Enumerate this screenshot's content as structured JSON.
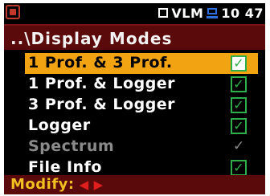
{
  "status": {
    "left_icon": "record-stop-icon",
    "box_icon": "square-outline-icon",
    "mode_text": "VLM",
    "usb_icon": "usb-monitor-icon",
    "time": "10 47"
  },
  "title": "..\\Display Modes",
  "items": [
    {
      "label": "1 Prof. & 3 Prof.",
      "checked": true,
      "enabled": true,
      "selected": true
    },
    {
      "label": "1 Prof. & Logger",
      "checked": true,
      "enabled": true,
      "selected": false
    },
    {
      "label": "3 Prof. & Logger",
      "checked": true,
      "enabled": true,
      "selected": false
    },
    {
      "label": "Logger",
      "checked": true,
      "enabled": true,
      "selected": false
    },
    {
      "label": "Spectrum",
      "checked": true,
      "enabled": false,
      "selected": false
    },
    {
      "label": "File Info",
      "checked": true,
      "enabled": true,
      "selected": false
    }
  ],
  "footer": {
    "label": "Modify:",
    "left_arrow_icon": "arrow-left-icon",
    "right_arrow_icon": "arrow-right-icon"
  },
  "check_glyph": "✓",
  "colors": {
    "title_bg": "#5a0a0a",
    "selection": "#f2a312",
    "check_green": "#2db04a",
    "footer_text": "#f0c020",
    "arrow_red": "#e01e1e"
  }
}
